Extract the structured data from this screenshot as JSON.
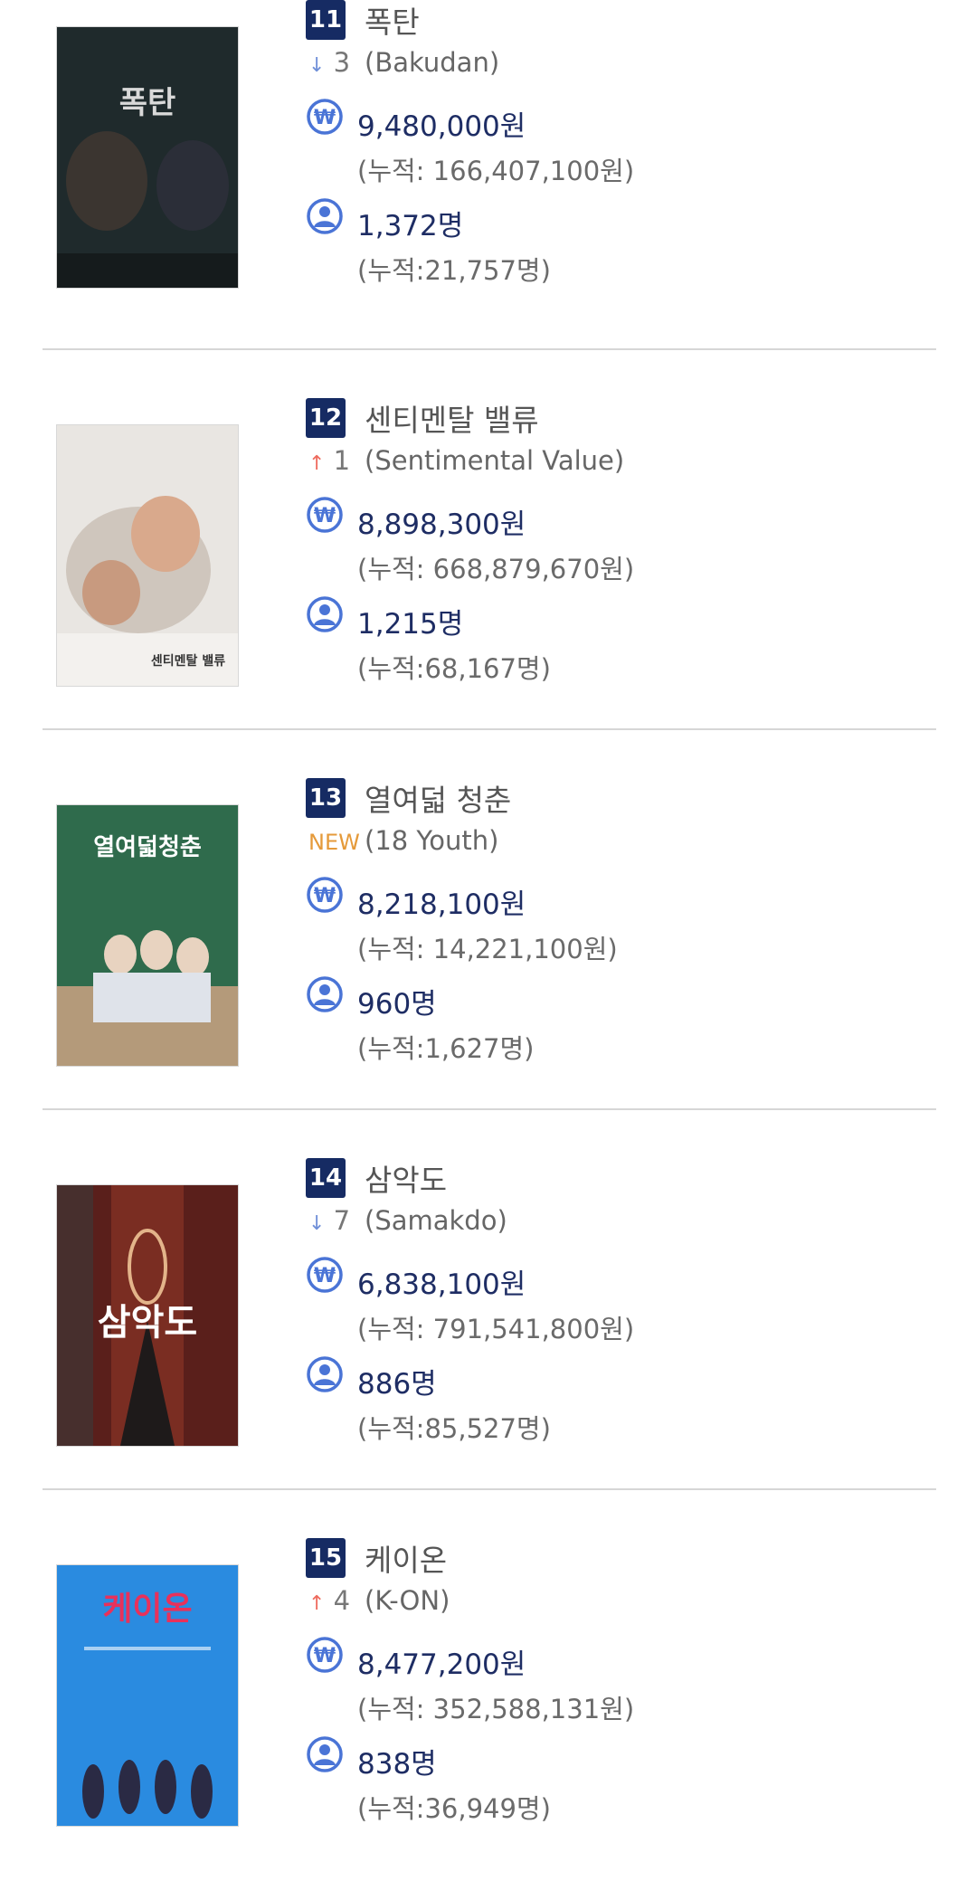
{
  "movies": [
    {
      "rank": "11",
      "title_ko": "폭탄",
      "title_en": "(Bakudan)",
      "change": {
        "dir": "down",
        "value": "3"
      },
      "sales": "9,480,000원",
      "sales_total": "(누적: 166,407,100원)",
      "audience": "1,372명",
      "audience_total": "(누적:21,757명)",
      "poster": {
        "bg": "#1f2a2c",
        "text": "폭탄",
        "text_color": "#d9d9d9"
      }
    },
    {
      "rank": "12",
      "title_ko": "센티멘탈 밸류",
      "title_en": "(Sentimental Value)",
      "change": {
        "dir": "up",
        "value": "1"
      },
      "sales": "8,898,300원",
      "sales_total": "(누적: 668,879,670원)",
      "audience": "1,215명",
      "audience_total": "(누적:68,167명)",
      "poster": {
        "bg": "#e9e6e2",
        "text": "센티멘탈 밸류",
        "text_color": "#333333"
      }
    },
    {
      "rank": "13",
      "title_ko": "열여덟 청춘",
      "title_en": "(18 Youth)",
      "change": {
        "dir": "new",
        "value": "NEW"
      },
      "sales": "8,218,100원",
      "sales_total": "(누적: 14,221,100원)",
      "audience": "960명",
      "audience_total": "(누적:1,627명)",
      "poster": {
        "bg": "#2f6b4c",
        "text": "열여덟청춘",
        "text_color": "#ffffff"
      }
    },
    {
      "rank": "14",
      "title_ko": "삼악도",
      "title_en": "(Samakdo)",
      "change": {
        "dir": "down",
        "value": "7"
      },
      "sales": "6,838,100원",
      "sales_total": "(누적: 791,541,800원)",
      "audience": "886명",
      "audience_total": "(누적:85,527명)",
      "poster": {
        "bg": "#5a1f1b",
        "text": "삼악도",
        "text_color": "#ffffff"
      }
    },
    {
      "rank": "15",
      "title_ko": "케이온",
      "title_en": "(K-ON)",
      "change": {
        "dir": "up",
        "value": "4"
      },
      "sales": "8,477,200원",
      "sales_total": "(누적: 352,588,131원)",
      "audience": "838명",
      "audience_total": "(누적:36,949명)",
      "poster": {
        "bg": "#2a8be0",
        "text": "케이온",
        "text_color": "#e8315b"
      }
    }
  ],
  "icons": {
    "won": "won-circle-icon",
    "person": "person-circle-icon",
    "down": "arrow-down-icon",
    "up": "arrow-up-icon"
  },
  "colors": {
    "badge": "#162b63",
    "amount": "#1e2d64",
    "icon": "#4a74d6",
    "up": "#ee6b5e",
    "down": "#6f8fd8",
    "new": "#e59a3a"
  }
}
